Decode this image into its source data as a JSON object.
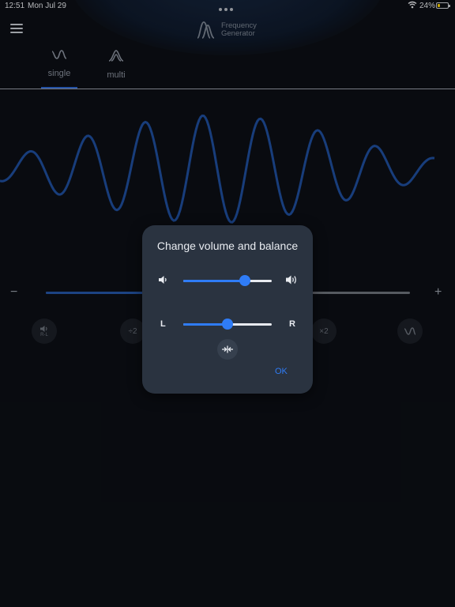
{
  "status": {
    "time": "12:51",
    "date": "Mon Jul 29",
    "battery": "24%",
    "battery_level": 0.24
  },
  "app": {
    "title_line1": "Frequency",
    "title_line2": "Generator"
  },
  "tabs": [
    {
      "label": "single",
      "icon": "single-wave-icon"
    },
    {
      "label": "multi",
      "icon": "multi-wave-icon"
    }
  ],
  "frequency": {
    "minus": "−",
    "plus": "+",
    "level": 0.28
  },
  "buttons": {
    "speaker_sub": "R-L",
    "divide": "÷2",
    "multiply": "×2",
    "waveform_icon": "sine-wave-icon"
  },
  "dialog": {
    "title": "Change volume and balance",
    "volume": 0.7,
    "balance": 0.5,
    "left_label": "L",
    "right_label": "R",
    "ok_label": "OK"
  },
  "colors": {
    "accent": "#2f7cf6",
    "wave": "#1f4f9e",
    "dialog_bg": "#2a3340",
    "background": "#0c0f15"
  }
}
